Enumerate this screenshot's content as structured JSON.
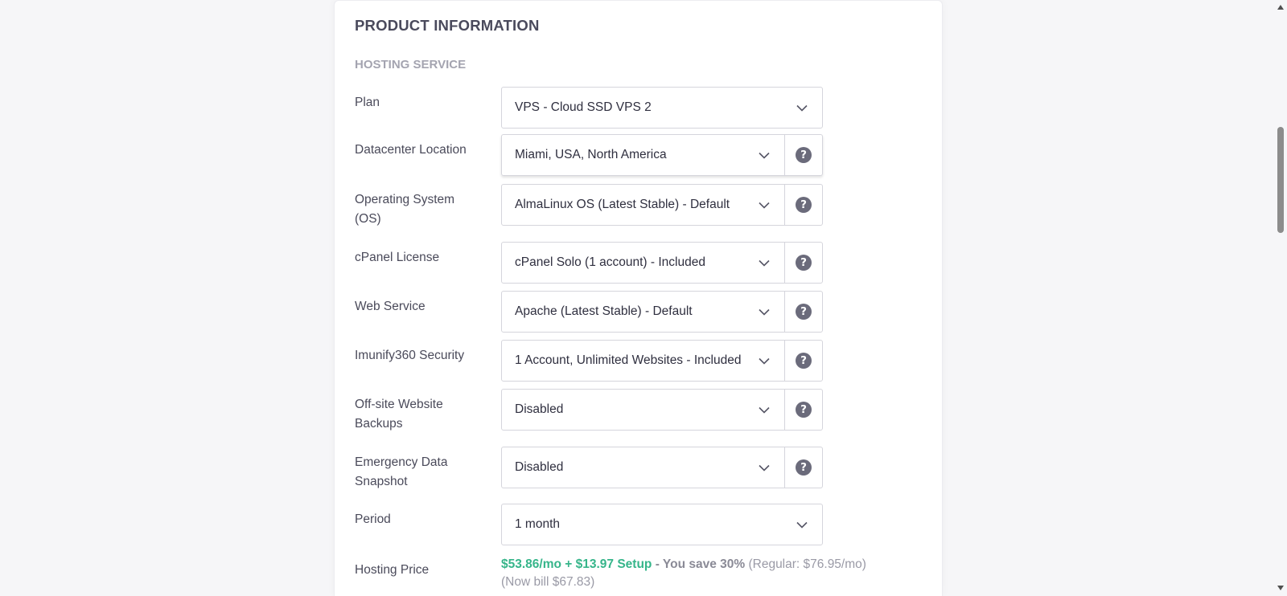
{
  "product": {
    "section_title": "PRODUCT INFORMATION",
    "subsection_title": "HOSTING SERVICE"
  },
  "fields": [
    {
      "label": "Plan",
      "value": "VPS - Cloud SSD VPS 2",
      "help": false
    },
    {
      "label": "Datacenter Location",
      "value": "Miami, USA, North America",
      "help": true
    },
    {
      "label": "Operating System (OS)",
      "value": "AlmaLinux OS (Latest Stable) - Default",
      "help": true
    },
    {
      "label": "cPanel License",
      "value": "cPanel Solo (1 account) - Included",
      "help": true
    },
    {
      "label": "Web Service",
      "value": "Apache (Latest Stable) - Default",
      "help": true
    },
    {
      "label": "Imunify360 Security",
      "value": "1 Account, Unlimited Websites - Included",
      "help": true
    },
    {
      "label": "Off-site Website Backups",
      "value": "Disabled",
      "help": true
    },
    {
      "label": "Emergency Data Snapshot",
      "value": "Disabled",
      "help": true
    },
    {
      "label": "Period",
      "value": "1 month",
      "help": false
    }
  ],
  "hosting_price": {
    "label": "Hosting Price",
    "price": "$53.86/mo + $13.97 Setup",
    "savings": "- You save 30%",
    "regular": "(Regular: $76.95/mo)",
    "bill": "(Now bill $67.83)"
  },
  "icons": {
    "help": "?",
    "chevron": "chevron-down-icon",
    "scroll_up": "scroll-up-arrow-icon",
    "scroll_down": "scroll-down-arrow-icon"
  },
  "colors": {
    "price_green": "#36b58a",
    "help_icon_bg": "#6b6b7b",
    "border": "#d5d5dc"
  }
}
